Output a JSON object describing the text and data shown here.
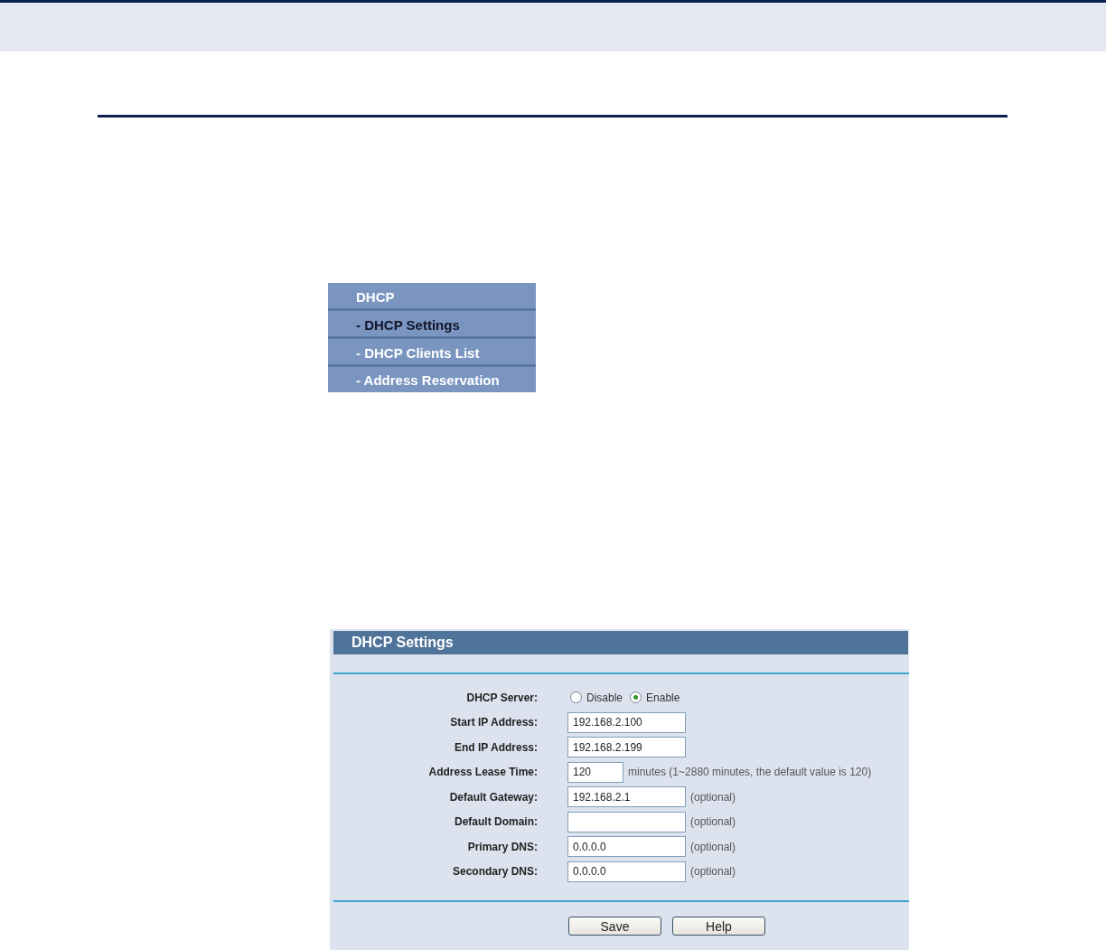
{
  "menu": [
    {
      "label": "DHCP",
      "selected": false
    },
    {
      "label": "- DHCP Settings",
      "selected": true
    },
    {
      "label": "- DHCP Clients List",
      "selected": false
    },
    {
      "label": "- Address Reservation",
      "selected": false
    }
  ],
  "panel": {
    "title": "DHCP Settings",
    "rows": [
      {
        "label": "DHCP Server:",
        "kind": "radio",
        "options": [
          {
            "label": "Disable",
            "selected": false
          },
          {
            "label": "Enable",
            "selected": true
          }
        ]
      },
      {
        "label": "Start IP Address:",
        "kind": "input",
        "value": "192.168.2.100"
      },
      {
        "label": "End IP Address:",
        "kind": "input",
        "value": "192.168.2.199"
      },
      {
        "label": "Address Lease Time:",
        "kind": "short-input",
        "value": "120",
        "note": "minutes (1~2880 minutes, the default value is 120)"
      },
      {
        "label": "Default Gateway:",
        "kind": "input",
        "value": "192.168.2.1",
        "note": "(optional)"
      },
      {
        "label": "Default Domain:",
        "kind": "input",
        "note": "(optional)"
      },
      {
        "label": "Primary DNS:",
        "kind": "input",
        "value": "0.0.0.0",
        "note": "(optional)"
      },
      {
        "label": "Secondary DNS:",
        "kind": "input",
        "value": "0.0.0.0",
        "note": "(optional)"
      }
    ],
    "buttons": [
      "Save",
      "Help"
    ]
  }
}
